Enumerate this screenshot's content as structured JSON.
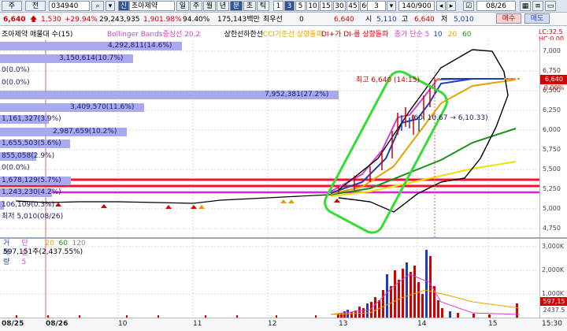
{
  "top_bar": {
    "menu_label": "주",
    "market_label": "전",
    "code": "034940",
    "badge": "신",
    "stock_name": "조아제약",
    "periods": [
      "일",
      "주",
      "월",
      "년",
      "분",
      "초",
      "틱"
    ],
    "period_selected": "분",
    "numbers": [
      "1",
      "3",
      "5",
      "10",
      "15",
      "30",
      "45",
      "60"
    ],
    "number_selected": "3",
    "count_value": "3",
    "pager": "140/900",
    "date": "08/26"
  },
  "quote_bar": {
    "price": "6,640",
    "change": "1,530",
    "change_pct": "+29.94%",
    "volume": "29,243,935",
    "vol_ratio": "1,901.98%",
    "strength": "94.40%",
    "amount": "175,143백만",
    "pref_label": "최우선",
    "pref_value": "0",
    "cur": "6,640",
    "open_label": "시",
    "open": "5,110",
    "high_label": "고",
    "high": "6,640",
    "low_label": "저",
    "low": "5,010",
    "buy_label": "매수",
    "sell_label": "매도"
  },
  "legend": {
    "title": "조아제약 매물대 수(15)",
    "items": [
      {
        "text": "Bollinger Bands중심선 20,2",
        "color": "#d43fd4"
      },
      {
        "text": "상한선",
        "color": "#000000"
      },
      {
        "text": "하한선",
        "color": "#000000"
      },
      {
        "text": "CCI기준선 상향돌파",
        "color": "#e6a200"
      },
      {
        "text": "DI+가 DI-를 상향돌파",
        "color": "#d40000"
      },
      {
        "text": "종가 단순 5",
        "color": "#d43fd4"
      },
      {
        "text": "10",
        "color": "#1a3fb8"
      },
      {
        "text": "20",
        "color": "#e6a200"
      },
      {
        "text": "60",
        "color": "#1a8f1a"
      }
    ],
    "hc_label": "LC:32.5",
    "hc_label2": "HC:0.00"
  },
  "volume_profile": [
    {
      "label": "4,292,811(14.6%)",
      "pct": 14.6
    },
    {
      "label": "3,150,614(10.7%)",
      "pct": 10.7
    },
    {
      "label": "0(0.0%)",
      "pct": 0
    },
    {
      "label": "0(0.0%)",
      "pct": 0
    },
    {
      "label": "7,952,381(27.2%)",
      "pct": 27.2
    },
    {
      "label": "3,409,570(11.6%)",
      "pct": 11.6
    },
    {
      "label": "1,161,327(3.9%)",
      "pct": 3.9
    },
    {
      "label": "2,987,659(10.2%)",
      "pct": 10.2
    },
    {
      "label": "1,655,503(5.6%)",
      "pct": 5.6
    },
    {
      "label": "855,058(2.9%)",
      "pct": 2.9
    },
    {
      "label": "0(0.0%)",
      "pct": 0
    },
    {
      "label": "1,678,129(5.7%)",
      "pct": 5.7
    },
    {
      "label": "1,243,230(4.2%)",
      "pct": 4.2
    },
    {
      "label": "106,109(0.3%)",
      "pct": 0.3
    },
    {
      "label": "최저 5,010(08/26)",
      "pct": 0
    }
  ],
  "annotations": {
    "high": "최고 6,640 (14:15)",
    "overlay": "(60, 10.67 → 6,10.33)"
  },
  "price_axis": {
    "ticks": [
      "7,000",
      "6,750",
      "6,500",
      "6,250",
      "6,000",
      "5,750",
      "5,500",
      "5,250",
      "5,000",
      "4,750"
    ],
    "current": "6,640",
    "current_pct": "0.00%"
  },
  "volume_panel": {
    "legend": [
      {
        "text": "거래량",
        "color": "#1a3fb8"
      },
      {
        "text": "단순 5",
        "color": "#d43fd4"
      },
      {
        "text": "20",
        "color": "#e6a200"
      },
      {
        "text": "60",
        "color": "#1a8f1a"
      },
      {
        "text": "120",
        "color": "#888888"
      }
    ],
    "value": "597,151주(2,437.55%)",
    "ticks": [
      "3,000K",
      "2,000K",
      "1,000K"
    ],
    "current": "597,15",
    "current2": "2437.5"
  },
  "x_axis": [
    "08/25",
    "08/26",
    "10",
    "11",
    "12",
    "13",
    "14",
    "15",
    "15:30"
  ],
  "colors": {
    "up": "#d40000",
    "down": "#1a3fb8",
    "highlight": "#33dd33",
    "resist": "#ff1030"
  }
}
